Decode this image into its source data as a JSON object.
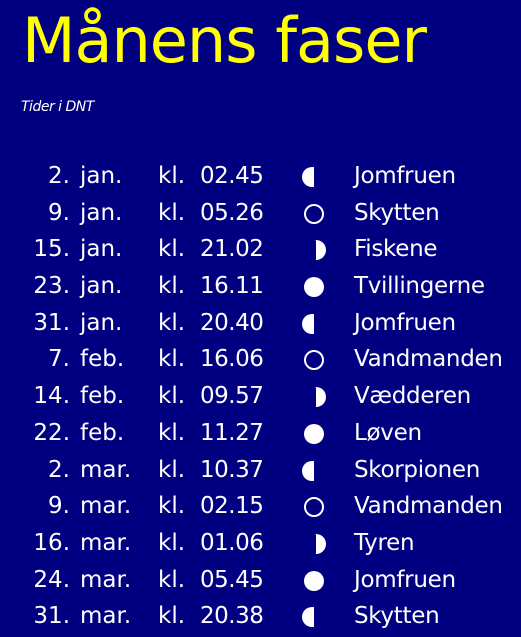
{
  "title": "Månens faser",
  "subtitle": "Tider i DNT",
  "colors": {
    "background": "#000080",
    "title": "#ffff00",
    "text": "#ffffff"
  },
  "rows": [
    {
      "day": "2.",
      "month": "jan.",
      "kl": "kl.",
      "time": "02.45",
      "phase": "waning-half-moon-icon",
      "sign": "Jomfruen"
    },
    {
      "day": "9.",
      "month": "jan.",
      "kl": "kl.",
      "time": "05.26",
      "phase": "new-moon-icon",
      "sign": "Skytten"
    },
    {
      "day": "15.",
      "month": "jan.",
      "kl": "kl.",
      "time": "21.02",
      "phase": "waxing-half-moon-icon",
      "sign": "Fiskene"
    },
    {
      "day": "23.",
      "month": "jan.",
      "kl": "kl.",
      "time": "16.11",
      "phase": "full-moon-icon",
      "sign": "Tvillingerne"
    },
    {
      "day": "31.",
      "month": "jan.",
      "kl": "kl.",
      "time": "20.40",
      "phase": "waning-half-moon-icon",
      "sign": "Jomfruen"
    },
    {
      "day": "7.",
      "month": "feb.",
      "kl": "kl.",
      "time": "16.06",
      "phase": "new-moon-icon",
      "sign": "Vandmanden"
    },
    {
      "day": "14.",
      "month": "feb.",
      "kl": "kl.",
      "time": "09.57",
      "phase": "waxing-half-moon-icon",
      "sign": "Vædderen"
    },
    {
      "day": "22.",
      "month": "feb.",
      "kl": "kl.",
      "time": "11.27",
      "phase": "full-moon-icon",
      "sign": "Løven"
    },
    {
      "day": "2.",
      "month": "mar.",
      "kl": "kl.",
      "time": "10.37",
      "phase": "waning-half-moon-icon",
      "sign": "Skorpionen"
    },
    {
      "day": "9.",
      "month": "mar.",
      "kl": "kl.",
      "time": "02.15",
      "phase": "new-moon-icon",
      "sign": "Vandmanden"
    },
    {
      "day": "16.",
      "month": "mar.",
      "kl": "kl.",
      "time": "01.06",
      "phase": "waxing-half-moon-icon",
      "sign": "Tyren"
    },
    {
      "day": "24.",
      "month": "mar.",
      "kl": "kl.",
      "time": "05.45",
      "phase": "full-moon-icon",
      "sign": "Jomfruen"
    },
    {
      "day": "31.",
      "month": "mar.",
      "kl": "kl.",
      "time": "20.38",
      "phase": "waning-half-moon-icon",
      "sign": "Skytten"
    }
  ]
}
